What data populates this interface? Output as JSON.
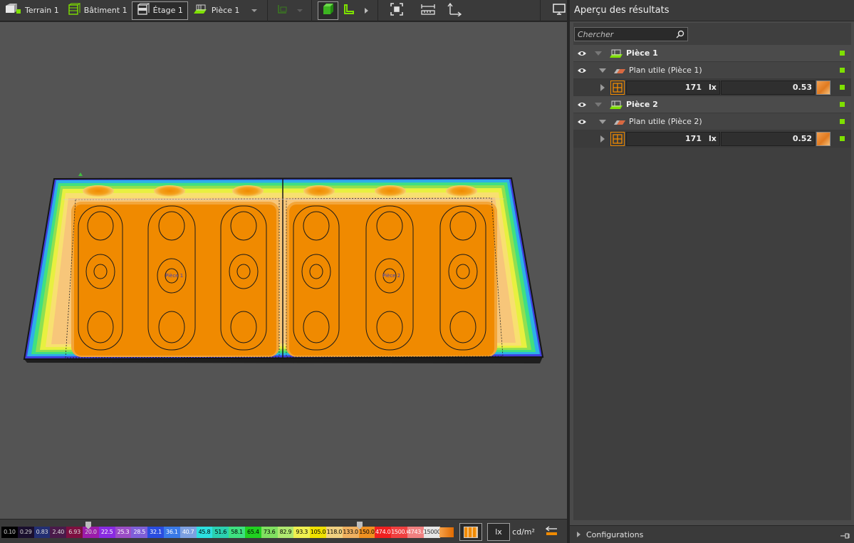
{
  "toolbar": {
    "terrain_label": "Terrain 1",
    "building_label": "Bâtiment 1",
    "floor_label": "Étage 1",
    "room_label": "Pièce 1"
  },
  "results_panel": {
    "title": "Aperçu des résultats",
    "search_placeholder": "Chercher",
    "rooms": [
      {
        "name": "Pièce 1",
        "plane": "Plan utile (Pièce 1)",
        "value": "171",
        "unit": "lx",
        "uniformity": "0.53"
      },
      {
        "name": "Pièce 2",
        "plane": "Plan utile (Pièce 2)",
        "value": "171",
        "unit": "lx",
        "uniformity": "0.52"
      }
    ],
    "configurations_label": "Configurations"
  },
  "legend": {
    "values": [
      "0.10",
      "0.29",
      "0.83",
      "2.40",
      "6.93",
      "20.0",
      "22.5",
      "25.3",
      "28.5",
      "32.1",
      "36.1",
      "40.7",
      "45.8",
      "51.6",
      "58.1",
      "65.4",
      "73.6",
      "82.9",
      "93.3",
      "105.0",
      "118.0",
      "133.0",
      "150.0",
      "474.0",
      "1500.0",
      "4743.0",
      "15000.0"
    ],
    "colors": [
      "#000000",
      "#1a0f2e",
      "#232f72",
      "#4a1a4a",
      "#7d1040",
      "#9c1cab",
      "#8a2be2",
      "#9b4dc6",
      "#7f5fd8",
      "#2a4de0",
      "#3a7ae8",
      "#7da0e0",
      "#2de0e0",
      "#2bd0b0",
      "#3ee080",
      "#20d020",
      "#80e060",
      "#b0e870",
      "#f0f050",
      "#f0e000",
      "#f0d080",
      "#f0b060",
      "#f09020",
      "#f02020",
      "#f04040",
      "#f08080",
      "#e6e6e6"
    ],
    "text_colors": [
      "#cfcfcf",
      "#cfcfcf",
      "#dddddd",
      "#dddddd",
      "#dddddd",
      "#dddddd",
      "#ffffff",
      "#ffffff",
      "#ffffff",
      "#ffffff",
      "#ffffff",
      "#ffffff",
      "#000000",
      "#000000",
      "#000000",
      "#000000",
      "#000000",
      "#000000",
      "#000000",
      "#000000",
      "#000000",
      "#000000",
      "#000000",
      "#ffffff",
      "#ffffff",
      "#ffffff",
      "#333333"
    ],
    "unit_lx": "lx",
    "unit_cdm2": "cd/m²"
  },
  "scene_labels": {
    "room1": "Pièce 1",
    "room2": "Pièce 2"
  },
  "colors": {
    "accent_green": "#7ee000",
    "accent_orange": "#f08a00",
    "toolbar_bg": "#3a3a3a",
    "viewport_bg": "#545454"
  },
  "icons": [
    "terrain-icon",
    "building-icon",
    "floor-icon",
    "room-icon",
    "dropdown-icon",
    "workplane-icon",
    "solid-view-icon",
    "l-shape-icon",
    "fit-view-icon",
    "measure-icon",
    "axes-icon",
    "monitor-icon",
    "eye-icon",
    "search-icon",
    "false-color-icon",
    "iso-line-icon",
    "swap-icon",
    "pin-icon"
  ]
}
